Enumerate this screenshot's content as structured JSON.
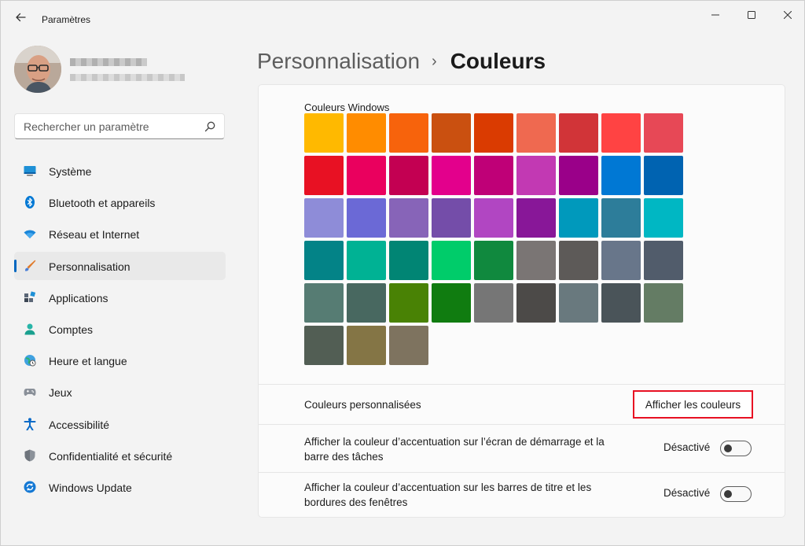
{
  "app": {
    "title": "Paramètres"
  },
  "search": {
    "placeholder": "Rechercher un paramètre"
  },
  "sidebar": {
    "items": [
      {
        "label": "Système",
        "icon": "system-icon",
        "selected": false
      },
      {
        "label": "Bluetooth et appareils",
        "icon": "bluetooth-icon",
        "selected": false
      },
      {
        "label": "Réseau et Internet",
        "icon": "wifi-icon",
        "selected": false
      },
      {
        "label": "Personnalisation",
        "icon": "brush-icon",
        "selected": true
      },
      {
        "label": "Applications",
        "icon": "apps-icon",
        "selected": false
      },
      {
        "label": "Comptes",
        "icon": "account-icon",
        "selected": false
      },
      {
        "label": "Heure et langue",
        "icon": "globe-clock-icon",
        "selected": false
      },
      {
        "label": "Jeux",
        "icon": "gamepad-icon",
        "selected": false
      },
      {
        "label": "Accessibilité",
        "icon": "accessibility-icon",
        "selected": false
      },
      {
        "label": "Confidentialité et sécurité",
        "icon": "shield-icon",
        "selected": false
      },
      {
        "label": "Windows Update",
        "icon": "update-icon",
        "selected": false
      }
    ]
  },
  "header": {
    "parent": "Personnalisation",
    "separator": "›",
    "current": "Couleurs"
  },
  "windows_colors": {
    "title": "Couleurs Windows",
    "swatches": [
      "#FFB900",
      "#FF8C00",
      "#F7630C",
      "#CA5010",
      "#DA3B01",
      "#EF6950",
      "#D13438",
      "#FF4343",
      "#E74856",
      "#E81123",
      "#EA005E",
      "#C30052",
      "#E3008C",
      "#BF0077",
      "#C239B3",
      "#9A0089",
      "#0078D4",
      "#0063B1",
      "#8E8CD8",
      "#6B69D6",
      "#8764B8",
      "#744DA9",
      "#B146C2",
      "#881798",
      "#0099BC",
      "#2D7D9A",
      "#00B7C3",
      "#038387",
      "#00B294",
      "#018574",
      "#00CC6A",
      "#10893E",
      "#7A7574",
      "#5D5A58",
      "#68768A",
      "#515C6B",
      "#567C73",
      "#486860",
      "#498205",
      "#107C10",
      "#767676",
      "#4C4A48",
      "#69797E",
      "#4A5459",
      "#647C64",
      "#525E54",
      "#847545",
      "#7E735F"
    ]
  },
  "custom_colors": {
    "label": "Couleurs personnalisées",
    "button": "Afficher les couleurs"
  },
  "accent_taskbar": {
    "label": "Afficher la couleur d’accentuation sur l’écran de démarrage et la barre des tâches",
    "state": "Désactivé",
    "on": false
  },
  "accent_titlebars": {
    "label": "Afficher la couleur d’accentuation sur les barres de titre et les bordures des fenêtres",
    "state": "Désactivé",
    "on": false
  },
  "colors": {
    "accent": "#0067c0",
    "highlight_border": "#e81123"
  }
}
